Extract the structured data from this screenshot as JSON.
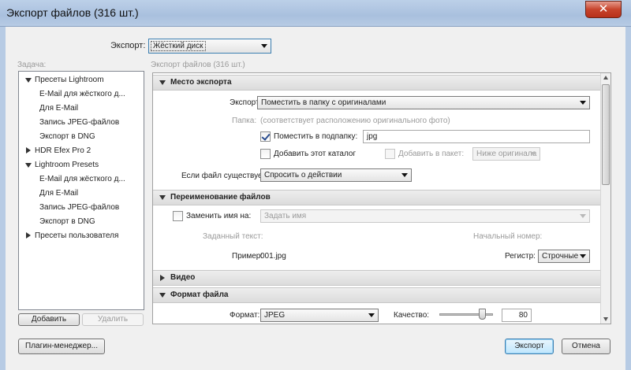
{
  "window": {
    "title": "Экспорт файлов (316 шт.)",
    "close_glyph": "✕"
  },
  "top": {
    "export_label": "Экспорт:",
    "export_value": "Жёсткий диск"
  },
  "sidebar": {
    "task_label": "Задача:",
    "groups": [
      {
        "label": "Пресеты Lightroom",
        "expanded": true,
        "items": [
          "E-Mail для жёсткого д...",
          "Для E-Mail",
          "Запись JPEG-файлов",
          "Экспорт в DNG"
        ]
      },
      {
        "label": "HDR Efex Pro 2",
        "expanded": false,
        "items": []
      },
      {
        "label": "Lightroom Presets",
        "expanded": true,
        "items": [
          "E-Mail для жёсткого д...",
          "Для E-Mail",
          "Запись JPEG-файлов",
          "Экспорт в DNG"
        ]
      },
      {
        "label": "Пресеты пользователя",
        "expanded": false,
        "items": []
      }
    ],
    "add_button": "Добавить",
    "remove_button": "Удалить"
  },
  "panel": {
    "header": "Экспорт файлов (316 шт.)",
    "export_location": {
      "title": "Место экспорта",
      "export_label": "Экспорт:",
      "export_value": "Поместить в папку с оригиналами",
      "folder_label": "Папка:",
      "folder_value": "(соответствует расположению оригинального фото)",
      "subfolder_label": "Поместить в подпапку:",
      "subfolder_checked": true,
      "subfolder_value": "jpg",
      "add_catalog_label": "Добавить этот каталог",
      "add_catalog_checked": false,
      "add_stack_label": "Добавить в пакет:",
      "stack_value": "Ниже оригинала",
      "exists_label": "Если файл существует:",
      "exists_value": "Спросить о действии"
    },
    "rename": {
      "title": "Переименование файлов",
      "rename_label": "Заменить имя на:",
      "rename_checked": false,
      "rename_value": "Задать имя",
      "custom_text_label": "Заданный текст:",
      "start_number_label": "Начальный номер:",
      "example_label": "Пример:",
      "example_value": "001.jpg",
      "case_label": "Регистр:",
      "case_value": "Строчные"
    },
    "video": {
      "title": "Видео"
    },
    "file_settings": {
      "title": "Формат файла",
      "format_label": "Формат:",
      "format_value": "JPEG",
      "quality_label": "Качество:",
      "quality_value": "80",
      "quality_fraction": 0.8
    }
  },
  "footer": {
    "plugin_button": "Плагин-менеджер...",
    "export_button": "Экспорт",
    "cancel_button": "Отмена"
  }
}
